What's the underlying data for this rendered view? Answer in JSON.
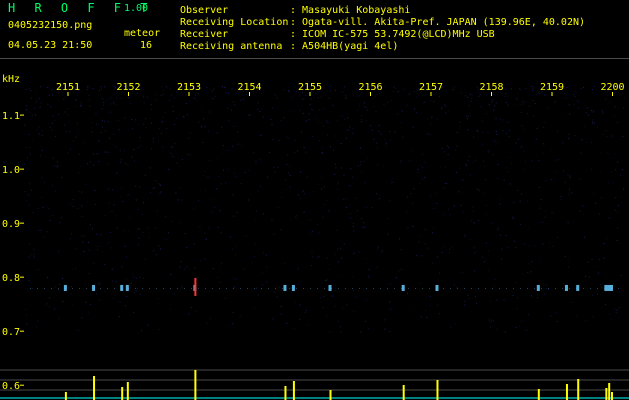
{
  "header": {
    "app_name": "H R O F F T",
    "version": "1.00",
    "filename": "0405232150.png",
    "datetime": "04.05.23 21:50",
    "meteor_label": "meteor",
    "meteor_count": "16",
    "info": [
      {
        "label": "Observer",
        "value": ": Masayuki Kobayashi"
      },
      {
        "label": "Receiving Location",
        "value": ": Ogata-vill. Akita-Pref. JAPAN (139.96E, 40.02N)"
      },
      {
        "label": "Receiver",
        "value": ": ICOM IC-575 53.7492(@LCD)MHz USB"
      },
      {
        "label": "Receiving antenna",
        "value": ": A504HB(yagi 4el)"
      }
    ]
  },
  "chart_data": {
    "type": "heatmap",
    "x_unit_label": "",
    "y_unit_label": "kHz",
    "time_ticks": [
      "2151",
      "2152",
      "2153",
      "2154",
      "2155",
      "2156",
      "2157",
      "2158",
      "2159",
      "2200"
    ],
    "freq_ticks": [
      "1.1",
      "1.0",
      "0.9",
      "0.8",
      "0.7",
      "0.6"
    ],
    "ylim": [
      0.6,
      1.15
    ],
    "echo_band_khz": 0.78,
    "meteor_events_minutes": [
      0.3,
      0.8,
      1.4,
      2.6,
      4.2,
      4.35,
      5.0,
      6.3,
      6.9,
      8.7,
      9.2,
      9.4,
      9.9,
      9.95,
      10.0,
      1.3
    ],
    "colors": {
      "background": "#000000",
      "noise": "#1a2266",
      "echo": "#66ccff",
      "echo_strong": "#ff3333",
      "count_bars": "#ffff00",
      "count_baseline": "#00ffff",
      "tick_text": "#ffff00",
      "grid_line": "#4a4a4a"
    }
  }
}
